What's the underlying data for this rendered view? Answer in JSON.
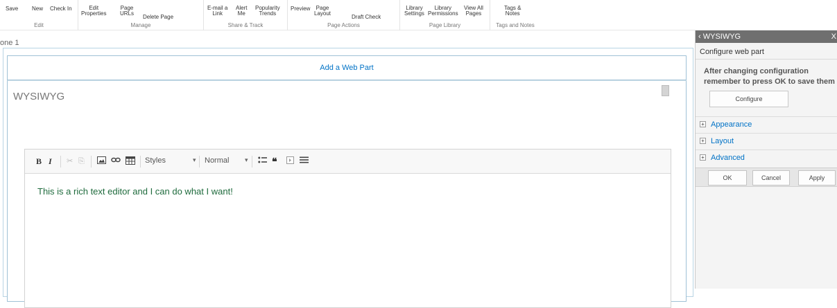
{
  "ribbon": {
    "groups": [
      {
        "label": "Edit",
        "buttons": [
          "Save",
          "New",
          "Check In"
        ]
      },
      {
        "label": "Manage",
        "buttons": [
          "Edit\nProperties",
          "Page\nURLs",
          "Delete Page"
        ]
      },
      {
        "label": "Share & Track",
        "buttons": [
          "E-mail a\nLink",
          "Alert\nMe",
          "Popularity\nTrends"
        ]
      },
      {
        "label": "Page Actions",
        "buttons": [
          "Preview",
          "Page\nLayout",
          "Draft Check"
        ]
      },
      {
        "label": "Page Library",
        "buttons": [
          "Library\nSettings",
          "Library\nPermissions",
          "View All\nPages"
        ]
      },
      {
        "label": "Tags and Notes",
        "buttons": [
          "Tags &\nNotes"
        ]
      }
    ]
  },
  "zone": {
    "label": "one 1",
    "add_webpart": "Add a Web Part"
  },
  "webpart": {
    "title": "WYSIWYG"
  },
  "editor": {
    "toolbar": {
      "styles_label": "Styles",
      "format_label": "Normal"
    },
    "content": "This is a rich text editor and I can do what I want!"
  },
  "toolpane": {
    "title": "‹ WYSIWYG",
    "close": "X",
    "subtitle": "Configure web part",
    "message": "After changing configuration remember to press OK to save them",
    "configure_label": "Configure",
    "sections": [
      "Appearance",
      "Layout",
      "Advanced"
    ],
    "ok_label": "OK",
    "cancel_label": "Cancel",
    "apply_label": "Apply"
  }
}
